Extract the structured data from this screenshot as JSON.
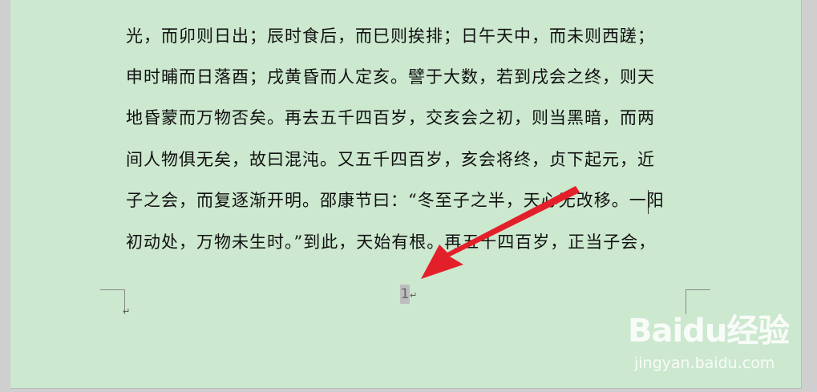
{
  "document": {
    "lines": [
      "光，而卯则日出；辰时食后，而巳则挨排；日午天中，而未则西蹉；",
      "申时晡而日落酉；戌黄昏而人定亥。譬于大数，若到戌会之终，则天",
      "地昏蒙而万物否矣。再去五千四百岁，交亥会之初，则当黑暗，而两",
      "间人物俱无矣，故曰混沌。又五千四百岁，亥会将终，贞下起元，近",
      "子之会，而复逐渐开明。邵康节曰：“冬至子之半，天心无改移。一阳",
      "初动处，万物未生时。”到此，天始有根。再五千四百岁，正当子会，"
    ],
    "paragraph_mark": "↵"
  },
  "footer": {
    "page_number": "1"
  },
  "annotation": {
    "arrow_color": "#e3202a"
  },
  "watermark": {
    "logo_text": "Baidu经验",
    "url_text": "jingyan.baidu.com"
  }
}
